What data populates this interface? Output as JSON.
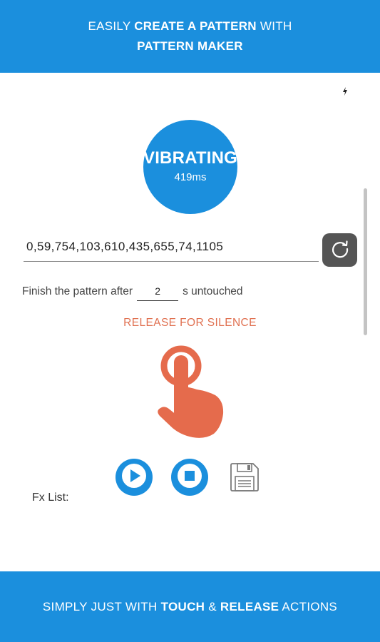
{
  "top_banner": {
    "line1_pre": "EASILY ",
    "line1_bold": "CREATE A PATTERN",
    "line1_post": " WITH",
    "line2_bold": "PATTERN MAKER"
  },
  "status": {
    "title": "VIBRATING",
    "duration": "419ms"
  },
  "pattern": {
    "value": "0,59,754,103,610,435,655,74,1105"
  },
  "finish": {
    "prefix": "Finish the pattern after",
    "seconds": "2",
    "suffix": "s untouched"
  },
  "release_text": "RELEASE FOR SILENCE",
  "fx_label": "Fx List:",
  "bottom_banner": {
    "pre": "SIMPLY JUST WITH ",
    "bold1": "TOUCH",
    "mid": " & ",
    "bold2": "RELEASE",
    "post": " ACTIONS"
  },
  "icons": {
    "flash": "flash-icon",
    "refresh": "refresh-icon",
    "hand": "touch-hand-icon",
    "play": "play-icon",
    "stop": "stop-icon",
    "save": "floppy-disk-icon"
  },
  "colors": {
    "accent": "#1b8fdd",
    "release": "#e07050",
    "refresh_bg": "#555555"
  }
}
